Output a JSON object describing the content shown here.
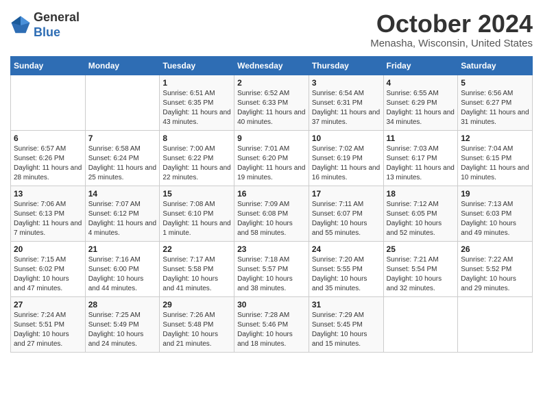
{
  "header": {
    "logo_general": "General",
    "logo_blue": "Blue",
    "month_title": "October 2024",
    "location": "Menasha, Wisconsin, United States"
  },
  "days_of_week": [
    "Sunday",
    "Monday",
    "Tuesday",
    "Wednesday",
    "Thursday",
    "Friday",
    "Saturday"
  ],
  "weeks": [
    [
      {
        "day": "",
        "info": ""
      },
      {
        "day": "",
        "info": ""
      },
      {
        "day": "1",
        "sunrise": "6:51 AM",
        "sunset": "6:35 PM",
        "daylight": "11 hours and 43 minutes."
      },
      {
        "day": "2",
        "sunrise": "6:52 AM",
        "sunset": "6:33 PM",
        "daylight": "11 hours and 40 minutes."
      },
      {
        "day": "3",
        "sunrise": "6:54 AM",
        "sunset": "6:31 PM",
        "daylight": "11 hours and 37 minutes."
      },
      {
        "day": "4",
        "sunrise": "6:55 AM",
        "sunset": "6:29 PM",
        "daylight": "11 hours and 34 minutes."
      },
      {
        "day": "5",
        "sunrise": "6:56 AM",
        "sunset": "6:27 PM",
        "daylight": "11 hours and 31 minutes."
      }
    ],
    [
      {
        "day": "6",
        "sunrise": "6:57 AM",
        "sunset": "6:26 PM",
        "daylight": "11 hours and 28 minutes."
      },
      {
        "day": "7",
        "sunrise": "6:58 AM",
        "sunset": "6:24 PM",
        "daylight": "11 hours and 25 minutes."
      },
      {
        "day": "8",
        "sunrise": "7:00 AM",
        "sunset": "6:22 PM",
        "daylight": "11 hours and 22 minutes."
      },
      {
        "day": "9",
        "sunrise": "7:01 AM",
        "sunset": "6:20 PM",
        "daylight": "11 hours and 19 minutes."
      },
      {
        "day": "10",
        "sunrise": "7:02 AM",
        "sunset": "6:19 PM",
        "daylight": "11 hours and 16 minutes."
      },
      {
        "day": "11",
        "sunrise": "7:03 AM",
        "sunset": "6:17 PM",
        "daylight": "11 hours and 13 minutes."
      },
      {
        "day": "12",
        "sunrise": "7:04 AM",
        "sunset": "6:15 PM",
        "daylight": "11 hours and 10 minutes."
      }
    ],
    [
      {
        "day": "13",
        "sunrise": "7:06 AM",
        "sunset": "6:13 PM",
        "daylight": "11 hours and 7 minutes."
      },
      {
        "day": "14",
        "sunrise": "7:07 AM",
        "sunset": "6:12 PM",
        "daylight": "11 hours and 4 minutes."
      },
      {
        "day": "15",
        "sunrise": "7:08 AM",
        "sunset": "6:10 PM",
        "daylight": "11 hours and 1 minute."
      },
      {
        "day": "16",
        "sunrise": "7:09 AM",
        "sunset": "6:08 PM",
        "daylight": "10 hours and 58 minutes."
      },
      {
        "day": "17",
        "sunrise": "7:11 AM",
        "sunset": "6:07 PM",
        "daylight": "10 hours and 55 minutes."
      },
      {
        "day": "18",
        "sunrise": "7:12 AM",
        "sunset": "6:05 PM",
        "daylight": "10 hours and 52 minutes."
      },
      {
        "day": "19",
        "sunrise": "7:13 AM",
        "sunset": "6:03 PM",
        "daylight": "10 hours and 49 minutes."
      }
    ],
    [
      {
        "day": "20",
        "sunrise": "7:15 AM",
        "sunset": "6:02 PM",
        "daylight": "10 hours and 47 minutes."
      },
      {
        "day": "21",
        "sunrise": "7:16 AM",
        "sunset": "6:00 PM",
        "daylight": "10 hours and 44 minutes."
      },
      {
        "day": "22",
        "sunrise": "7:17 AM",
        "sunset": "5:58 PM",
        "daylight": "10 hours and 41 minutes."
      },
      {
        "day": "23",
        "sunrise": "7:18 AM",
        "sunset": "5:57 PM",
        "daylight": "10 hours and 38 minutes."
      },
      {
        "day": "24",
        "sunrise": "7:20 AM",
        "sunset": "5:55 PM",
        "daylight": "10 hours and 35 minutes."
      },
      {
        "day": "25",
        "sunrise": "7:21 AM",
        "sunset": "5:54 PM",
        "daylight": "10 hours and 32 minutes."
      },
      {
        "day": "26",
        "sunrise": "7:22 AM",
        "sunset": "5:52 PM",
        "daylight": "10 hours and 29 minutes."
      }
    ],
    [
      {
        "day": "27",
        "sunrise": "7:24 AM",
        "sunset": "5:51 PM",
        "daylight": "10 hours and 27 minutes."
      },
      {
        "day": "28",
        "sunrise": "7:25 AM",
        "sunset": "5:49 PM",
        "daylight": "10 hours and 24 minutes."
      },
      {
        "day": "29",
        "sunrise": "7:26 AM",
        "sunset": "5:48 PM",
        "daylight": "10 hours and 21 minutes."
      },
      {
        "day": "30",
        "sunrise": "7:28 AM",
        "sunset": "5:46 PM",
        "daylight": "10 hours and 18 minutes."
      },
      {
        "day": "31",
        "sunrise": "7:29 AM",
        "sunset": "5:45 PM",
        "daylight": "10 hours and 15 minutes."
      },
      {
        "day": "",
        "info": ""
      },
      {
        "day": "",
        "info": ""
      }
    ]
  ],
  "labels": {
    "sunrise": "Sunrise:",
    "sunset": "Sunset:",
    "daylight": "Daylight:"
  }
}
